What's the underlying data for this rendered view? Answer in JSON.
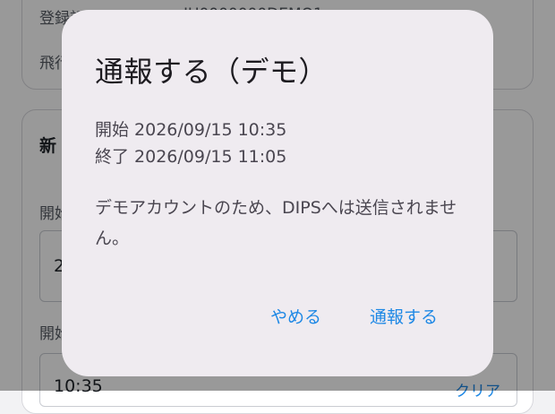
{
  "background": {
    "reg_label": "登録記号",
    "reg_value": "JU0000000DEMO1",
    "flight_label": "飛行",
    "section_title": "新",
    "start_date_label": "開始",
    "start_date_value": "2",
    "start_time_label": "開始",
    "start_time_value": "10:35",
    "clear_link": "クリア"
  },
  "dialog": {
    "title": "通報する（デモ）",
    "start_line": "開始 2026/09/15 10:35",
    "end_line": "終了 2026/09/15 11:05",
    "message": "デモアカウントのため、DIPSへは送信されません。",
    "cancel_label": "やめる",
    "confirm_label": "通報する"
  }
}
